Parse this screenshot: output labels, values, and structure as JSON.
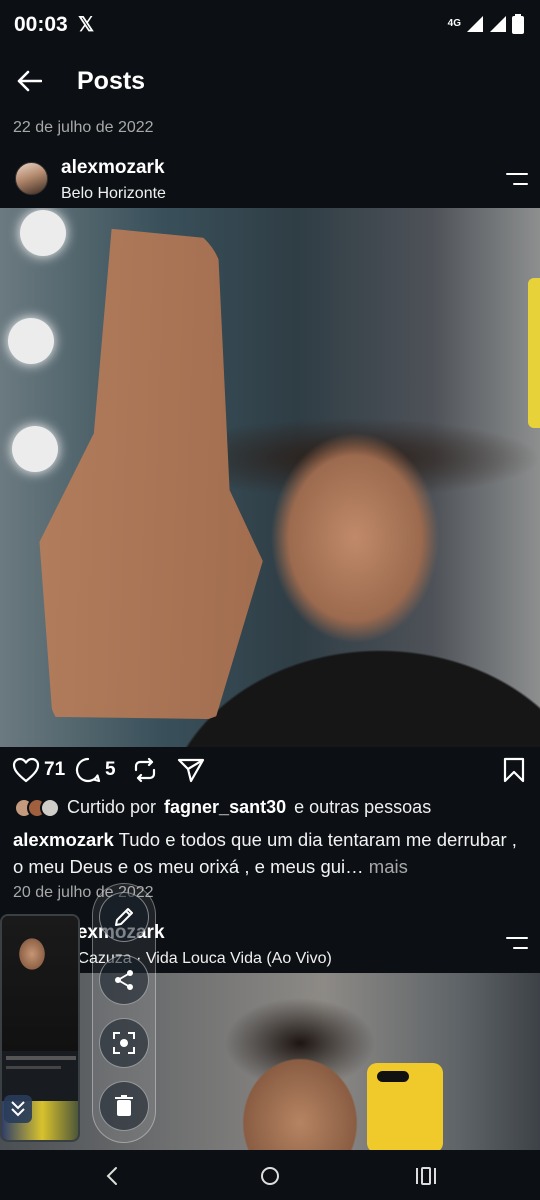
{
  "status_bar": {
    "time": "00:03",
    "x_icon": "𝕏",
    "network": "4G"
  },
  "header": {
    "title": "Posts"
  },
  "post1": {
    "date": "22 de julho de 2022",
    "username": "alexmozark",
    "location": "Belo Horizonte",
    "likes_count": "71",
    "comments_count": "5",
    "liked_by_prefix": "Curtido por",
    "liked_by_user": "fagner_sant30",
    "liked_by_suffix": "e outras pessoas",
    "caption_user": "alexmozark",
    "caption_text": "Tudo e todos que um dia tentaram me derrubar , o  meu Deus e os meu orixá , e meus gui…",
    "caption_more": "mais"
  },
  "post2": {
    "date": "20 de julho de 2022",
    "username": "alexmozark",
    "song": "Cazuza · Vida Louca Vida (Ao Vivo)"
  },
  "icons": {
    "back": "arrow-left-icon",
    "like": "heart-icon",
    "comment": "comment-icon",
    "repost": "repost-icon",
    "share": "send-icon",
    "save": "bookmark-icon",
    "more": "more-icon",
    "music": "music-note-icon",
    "edit": "pencil-icon",
    "share_tool": "share-icon",
    "scan": "scan-icon",
    "delete": "trash-icon",
    "nav_back": "nav-back-icon",
    "nav_home": "nav-home-icon",
    "nav_recents": "nav-recents-icon"
  },
  "colors": {
    "background": "#0c1014",
    "secondary_text": "#a8a8a8"
  }
}
